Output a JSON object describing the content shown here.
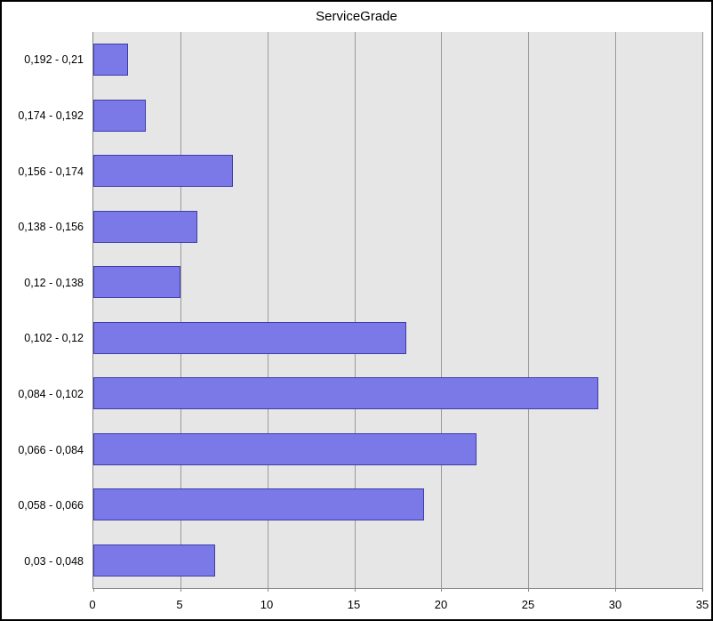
{
  "chart_data": {
    "type": "bar",
    "orientation": "horizontal",
    "title": "ServiceGrade",
    "xlabel": "",
    "ylabel": "",
    "xlim": [
      0,
      35
    ],
    "xticks": [
      0,
      5,
      10,
      15,
      20,
      25,
      30,
      35
    ],
    "categories": [
      "0,03 - 0,048",
      "0,058 - 0,066",
      "0,066 - 0,084",
      "0,084 - 0,102",
      "0,102 - 0,12",
      "0,12 - 0,138",
      "0,138 - 0,156",
      "0,156 - 0,174",
      "0,174 - 0,192",
      "0,192 - 0,21"
    ],
    "values": [
      7,
      19,
      22,
      29,
      18,
      5,
      6,
      8,
      3,
      2
    ]
  },
  "colors": {
    "plot_bg": "#e6e6e6",
    "bar_fill": "#7b79e8",
    "bar_stroke": "#3e3da8",
    "grid": "#9b9b9b"
  }
}
